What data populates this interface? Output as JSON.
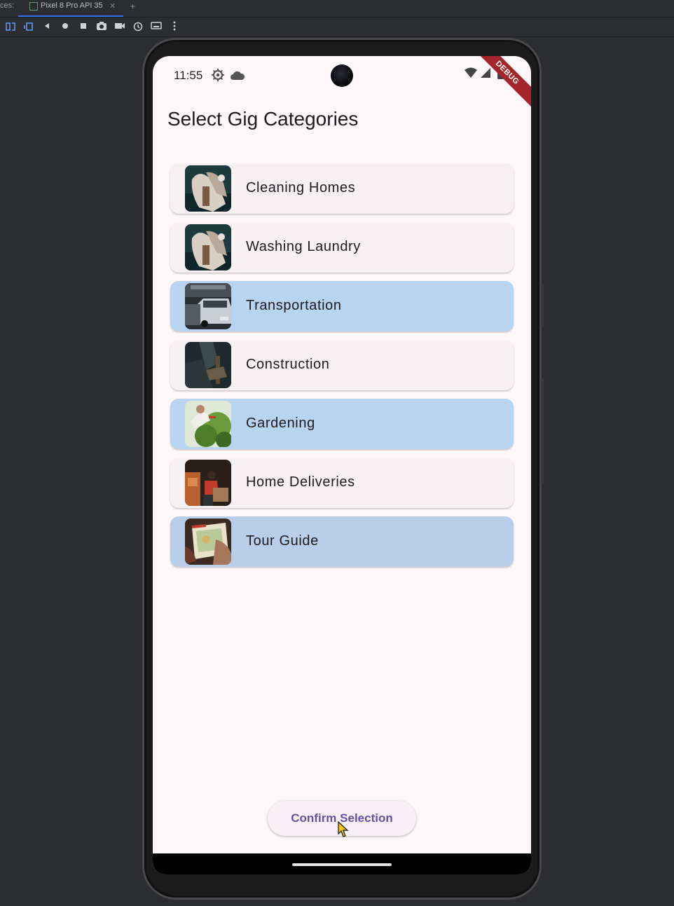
{
  "ide": {
    "tab_fragment": "ces:",
    "tab_label": "Pixel 8 Pro API 35",
    "tab_close": "✕",
    "add_tab": "+"
  },
  "toolbar": {
    "icons": [
      "mirror-icon",
      "rotate-icon",
      "back-icon",
      "home-icon",
      "overview-icon",
      "screenshot-icon",
      "record-icon",
      "snapshot-icon",
      "keyboard-icon",
      "more-icon"
    ]
  },
  "status_bar": {
    "time": "11:55",
    "debug_banner": "DEBUG"
  },
  "page": {
    "title": "Select Gig Categories"
  },
  "categories": [
    {
      "label": "Cleaning Homes",
      "selected": false
    },
    {
      "label": "Washing Laundry",
      "selected": false
    },
    {
      "label": "Transportation",
      "selected": true
    },
    {
      "label": "Construction",
      "selected": false
    },
    {
      "label": "Gardening",
      "selected": true
    },
    {
      "label": "Home Deliveries",
      "selected": false
    },
    {
      "label": "Tour Guide",
      "selected": true
    }
  ],
  "actions": {
    "confirm_label": "Confirm Selection"
  },
  "colors": {
    "selected_card": "#b8d4f0",
    "unselected_card": "#f7f1f4",
    "accent": "#6750a4",
    "debug_banner": "#a4262c"
  }
}
